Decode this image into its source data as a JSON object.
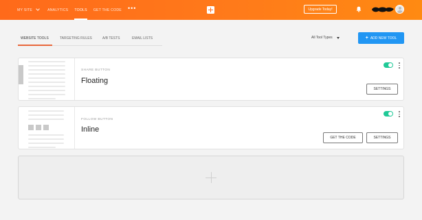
{
  "topbar": {
    "site_label": "MY SITE",
    "nav": [
      "ANALYTICS",
      "TOOLS",
      "GET THE CODE"
    ],
    "more_label": "•••",
    "upgrade_label": "Upgrade Today!",
    "brand_color": "#ff6a1a"
  },
  "tabs": [
    "WEBSITE TOOLS",
    "TARGETING RULES",
    "A/B TESTS",
    "EMAIL LISTS"
  ],
  "filter": {
    "label": "All Tool Types"
  },
  "add_button": {
    "label": "ADD NEW TOOL",
    "color": "#2196f3"
  },
  "tools": [
    {
      "type": "SHARE BUTTON",
      "name": "Floating",
      "enabled": true,
      "settings_label": "SETTINGS"
    },
    {
      "type": "FOLLOW BUTTON",
      "name": "Inline",
      "enabled": true,
      "code_label": "GET THE CODE",
      "settings_label": "SETTINGS"
    }
  ],
  "toggle_color": "#20c997"
}
